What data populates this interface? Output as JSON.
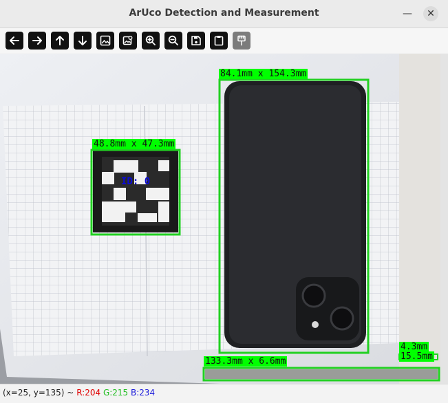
{
  "window": {
    "title": "ArUco Detection and Measurement",
    "controls": [
      {
        "name": "minimize",
        "glyph": "—"
      },
      {
        "name": "close",
        "glyph": "✕"
      }
    ]
  },
  "toolbar": {
    "buttons": [
      {
        "name": "pan-left",
        "icon": "arrow-left-icon"
      },
      {
        "name": "pan-right",
        "icon": "arrow-right-icon"
      },
      {
        "name": "pan-up",
        "icon": "arrow-up-icon"
      },
      {
        "name": "pan-down",
        "icon": "arrow-down-icon"
      },
      {
        "name": "zoom-in-image",
        "icon": "image-icon"
      },
      {
        "name": "zoom-out-image",
        "icon": "image-zoom-icon"
      },
      {
        "name": "zoom-in",
        "icon": "zoom-in-icon"
      },
      {
        "name": "zoom-out",
        "icon": "zoom-out-icon"
      },
      {
        "name": "save",
        "icon": "save-icon"
      },
      {
        "name": "copy",
        "icon": "clipboard-icon"
      },
      {
        "name": "properties",
        "icon": "brush-icon",
        "disabled": true
      }
    ]
  },
  "detections": {
    "marker": {
      "id_text": "ID: 0",
      "size_label": "48.8mm x 47.3mm"
    },
    "phone": {
      "size_label": "84.1mm x 154.3mm"
    },
    "strip": {
      "size_label": "133.3mm x 6.6mm"
    },
    "small": {
      "size_label": "4.3mm",
      "overlap_label": "15.5mm"
    }
  },
  "colors": {
    "box": "#22d022",
    "label_bg": "#00ff00",
    "id_text": "#0b0bd8"
  },
  "status": {
    "coords": "(x=25, y=135) ~",
    "r": "R:204",
    "g": "G:215",
    "b": "B:234"
  }
}
